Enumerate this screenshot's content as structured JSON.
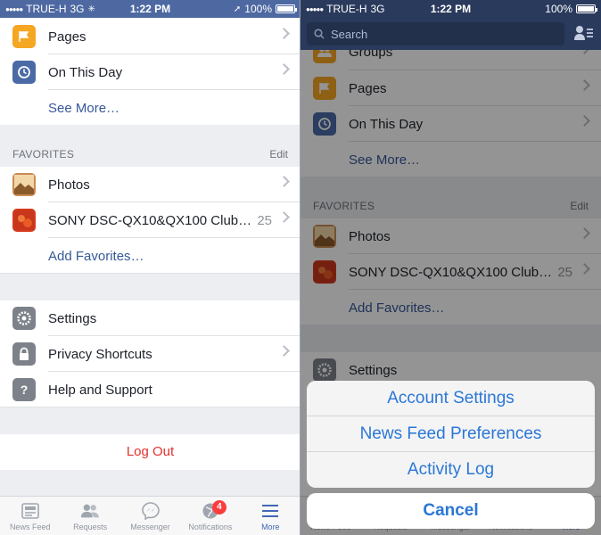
{
  "status_left": {
    "carrier": "TRUE-H",
    "network": "3G",
    "time": "1:22 PM",
    "battery": "100%"
  },
  "status_right": {
    "carrier": "TRUE-H",
    "network": "3G",
    "time": "1:22 PM",
    "battery": "100%"
  },
  "left": {
    "menu_top": [
      {
        "label": "Pages",
        "icon": "flag-icon"
      },
      {
        "label": "On This Day",
        "icon": "clock-icon"
      }
    ],
    "see_more": "See More…",
    "favorites_header": {
      "title": "FAVORITES",
      "edit": "Edit"
    },
    "favorites": [
      {
        "label": "Photos",
        "count": ""
      },
      {
        "label": "SONY DSC-QX10&QX100 Club…",
        "count": "25"
      }
    ],
    "add_favorites": "Add Favorites…",
    "settings_items": [
      {
        "label": "Settings"
      },
      {
        "label": "Privacy Shortcuts"
      },
      {
        "label": "Help and Support"
      }
    ],
    "logout": "Log Out"
  },
  "tabs": [
    {
      "label": "News Feed",
      "icon": "news-feed-icon",
      "active": false
    },
    {
      "label": "Requests",
      "icon": "friend-requests-icon",
      "active": false
    },
    {
      "label": "Messenger",
      "icon": "messenger-icon",
      "active": false
    },
    {
      "label": "Notifications",
      "icon": "globe-icon",
      "active": false,
      "badge": "4"
    },
    {
      "label": "More",
      "icon": "menu-icon",
      "active": true
    }
  ],
  "right": {
    "search_placeholder": "Search",
    "menu_top": [
      {
        "label": "Groups"
      },
      {
        "label": "Pages"
      },
      {
        "label": "On This Day"
      }
    ],
    "see_more": "See More…",
    "favorites_header": {
      "title": "FAVORITES",
      "edit": "Edit"
    },
    "favorites": [
      {
        "label": "Photos",
        "count": ""
      },
      {
        "label": "SONY DSC-QX10&QX100 Club…",
        "count": "25"
      }
    ],
    "add_favorites": "Add Favorites…",
    "settings_label": "Settings",
    "action_sheet": {
      "options": [
        "Account Settings",
        "News Feed Preferences",
        "Activity Log"
      ],
      "cancel": "Cancel"
    }
  },
  "colors": {
    "brand_blue": "#4e69a2",
    "link_blue": "#365899",
    "ios_blue": "#2a77d6",
    "logout_red": "#e0312d",
    "badge_red": "#fa3e3e"
  }
}
